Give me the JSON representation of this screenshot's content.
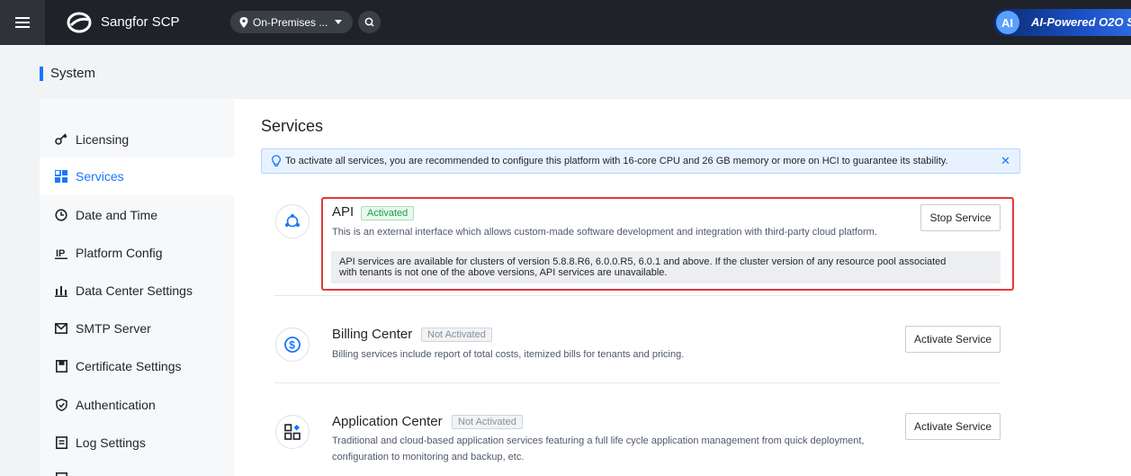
{
  "topbar": {
    "brand": "Sangfor SCP",
    "env_selector": "On-Premises ...",
    "ai_badge": "AI-Powered O2O S"
  },
  "page": {
    "title": "System"
  },
  "sidebar": {
    "items": [
      {
        "label": "Licensing",
        "icon": "key-icon"
      },
      {
        "label": "Services",
        "icon": "grid-icon",
        "active": true
      },
      {
        "label": "Date and Time",
        "icon": "clock-icon"
      },
      {
        "label": "Platform Config",
        "icon": "ip-icon"
      },
      {
        "label": "Data Center Settings",
        "icon": "bar-chart-icon"
      },
      {
        "label": "SMTP Server",
        "icon": "mail-icon"
      },
      {
        "label": "Certificate Settings",
        "icon": "certificate-icon"
      },
      {
        "label": "Authentication",
        "icon": "shield-icon"
      },
      {
        "label": "Log Settings",
        "icon": "log-icon"
      }
    ]
  },
  "main": {
    "title": "Services",
    "notice": "To activate all services, you are recommended to configure this platform with 16-core CPU and 26 GB memory or more on HCI to guarantee its stability.",
    "services": [
      {
        "name": "API",
        "status": "Activated",
        "description": "This is an external interface which allows custom-made software development and integration with third-party cloud platform.",
        "note_line1": "API services are available for clusters of version 5.8.8.R6, 6.0.0.R5, 6.0.1 and above. If the cluster version of any resource pool associated",
        "note_line2": "with tenants is not one of the above versions, API services are unavailable.",
        "button": "Stop Service",
        "icon": "api-icon"
      },
      {
        "name": "Billing Center",
        "status": "Not Activated",
        "description": "Billing services include report of total costs, itemized bills for tenants and pricing.",
        "button": "Activate Service",
        "icon": "dollar-icon"
      },
      {
        "name": "Application Center",
        "status": "Not Activated",
        "description_line1": "Traditional and cloud-based application services featuring a full life cycle application management from quick deployment,",
        "description_line2": "configuration to monitoring and backup, etc.",
        "button": "Activate Service",
        "icon": "apps-icon"
      }
    ]
  },
  "colors": {
    "accent": "#1677ff",
    "activated": "#16a34a",
    "highlight": "#e03a3a",
    "topbar": "#1f2329"
  }
}
